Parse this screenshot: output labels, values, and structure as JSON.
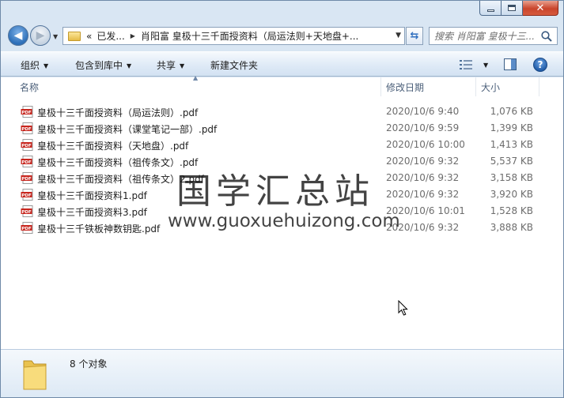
{
  "window": {
    "caption_buttons": [
      "minimize",
      "maximize",
      "close"
    ]
  },
  "nav": {
    "back_icon": "arrow-left-icon",
    "forward_icon": "arrow-right-icon"
  },
  "address": {
    "overflow": "«",
    "segments": [
      "已发...",
      "肖阳富 皇极十三千面授资料（局运法则+天地盘+..."
    ]
  },
  "search": {
    "placeholder": "搜索 肖阳富 皇极十三..."
  },
  "toolbar": {
    "organize": "组织",
    "include_in_library": "包含到库中",
    "share": "共享",
    "new_folder": "新建文件夹"
  },
  "columns": {
    "name": "名称",
    "date": "修改日期",
    "size": "大小"
  },
  "files": [
    {
      "name": "皇极十三千面授资料（局运法则）.pdf",
      "date": "2020/10/6 9:40",
      "size": "1,076 KB"
    },
    {
      "name": "皇极十三千面授资料（课堂笔记一部）.pdf",
      "date": "2020/10/6 9:59",
      "size": "1,399 KB"
    },
    {
      "name": "皇极十三千面授资料（天地盘）.pdf",
      "date": "2020/10/6 10:00",
      "size": "1,413 KB"
    },
    {
      "name": "皇极十三千面授资料（祖传条文）.pdf",
      "date": "2020/10/6 9:32",
      "size": "5,537 KB"
    },
    {
      "name": "皇极十三千面授资料（祖传条文）2.pdf",
      "date": "2020/10/6 9:32",
      "size": "3,158 KB"
    },
    {
      "name": "皇极十三千面授资料1.pdf",
      "date": "2020/10/6 9:32",
      "size": "3,920 KB"
    },
    {
      "name": "皇极十三千面授资料3.pdf",
      "date": "2020/10/6 10:01",
      "size": "1,528 KB"
    },
    {
      "name": "皇极十三千铁板神数钥匙.pdf",
      "date": "2020/10/6 9:32",
      "size": "3,888 KB"
    }
  ],
  "watermark": {
    "title": "国学汇总站",
    "url": "www.guoxuehuizong.com"
  },
  "status": {
    "count_text": "8 个对象"
  },
  "colors": {
    "frame": "#d9e6f3",
    "close_button": "#c9452c",
    "pdf_icon": "#c8261e"
  }
}
